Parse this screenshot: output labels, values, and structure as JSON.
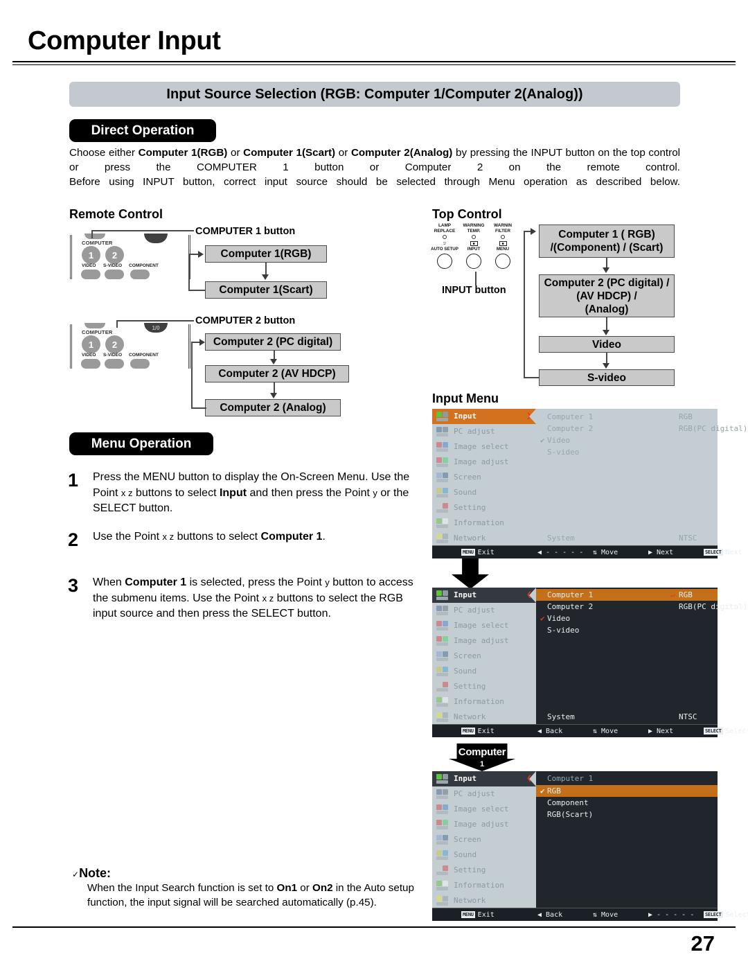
{
  "page": {
    "chapter_title": "Computer Input",
    "section_title": "Input Source Selection (RGB: Computer 1/Computer 2(Analog))",
    "page_number": "27"
  },
  "direct_operation": {
    "heading": "Direct Operation",
    "para_line1_pre": "Choose either ",
    "para_b1": "Computer 1(RGB)",
    "para_mid1": " or ",
    "para_b2": "Computer 1(Scart)",
    "para_mid2": " or ",
    "para_b3": "Computer 2(Analog)",
    "para_line1_post": " by pressing the INPUT button on the top control or press the COMPUTER 1 button or Computer 2 on the remote control.",
    "para_line2": "Before using INPUT button, correct input source should be selected through Menu operation as described below."
  },
  "remote_control": {
    "heading": "Remote Control",
    "computer1_callout": "COMPUTER 1 button",
    "computer2_callout": "COMPUTER 2 button",
    "device_labels": {
      "computer": "COMPUTER",
      "btn1": "1",
      "btn2": "2",
      "video": "VIDEO",
      "svideo": "S-VIDEO",
      "component": "COMPONENT"
    },
    "flow_group1": [
      "Computer 1(RGB)",
      "Computer 1(Scart)"
    ],
    "flow_group2": [
      "Computer 2 (PC digital)",
      "Computer 2 (AV HDCP)",
      "Computer 2 (Analog)"
    ]
  },
  "top_control": {
    "heading": "Top Control",
    "input_button_callout": "INPUT button",
    "indicators": [
      {
        "line1": "LAMP",
        "line2": "REPLACE"
      },
      {
        "line1": "WARNING",
        "line2": "TEMP."
      },
      {
        "line1": "WARNIN",
        "line2": "FILTER"
      }
    ],
    "buttons": [
      "AUTO SETUP",
      "INPUT",
      "MENU"
    ],
    "flow": [
      {
        "line1": "Computer 1 ( RGB)",
        "line2": "/(Component) / (Scart)"
      },
      {
        "line1": "Computer 2 (PC digital) /",
        "line2": "(AV HDCP) /",
        "line3": "(Analog)"
      },
      {
        "line1": "Video"
      },
      {
        "line1": "S-video"
      }
    ]
  },
  "menu_operation": {
    "heading": "Menu Operation",
    "steps": [
      {
        "num": "1",
        "parts": [
          {
            "t": "Press the MENU button to display the On-Screen Menu. Use the Point ",
            "b": false
          },
          {
            "t": "x z",
            "b": false,
            "pt": true
          },
          {
            "t": " buttons to select ",
            "b": false
          },
          {
            "t": "Input",
            "b": true
          },
          {
            "t": " and then press the Point ",
            "b": false
          },
          {
            "t": "y",
            "b": false,
            "pt": true
          },
          {
            "t": " or the SELECT button.",
            "b": false
          }
        ]
      },
      {
        "num": "2",
        "parts": [
          {
            "t": "Use the Point ",
            "b": false
          },
          {
            "t": "x z",
            "b": false,
            "pt": true
          },
          {
            "t": " buttons to select ",
            "b": false
          },
          {
            "t": "Computer 1",
            "b": true
          },
          {
            "t": ".",
            "b": false
          }
        ]
      },
      {
        "num": "3",
        "parts": [
          {
            "t": "When ",
            "b": false
          },
          {
            "t": "Computer 1",
            "b": true
          },
          {
            "t": " is selected, press the Point ",
            "b": false
          },
          {
            "t": "y",
            "b": false,
            "pt": true
          },
          {
            "t": " button to access the submenu items. Use the Point ",
            "b": false
          },
          {
            "t": "x z",
            "b": false,
            "pt": true
          },
          {
            "t": " buttons to select the RGB input source and then press the SELECT button.",
            "b": false
          }
        ]
      }
    ]
  },
  "note": {
    "check": "✓",
    "title": "Note:",
    "parts": [
      {
        "t": "When the Input Search function is set to ",
        "b": false
      },
      {
        "t": "On1",
        "b": true
      },
      {
        "t": " or ",
        "b": false
      },
      {
        "t": "On2",
        "b": true
      },
      {
        "t": " in the Auto setup function, the input signal will be searched automatically (p.45).",
        "b": false
      }
    ]
  },
  "input_menu": {
    "heading": "Input Menu",
    "sidebar_items": [
      {
        "label": "Input",
        "icon": "input-icon"
      },
      {
        "label": "PC adjust",
        "icon": "pc-adjust-icon"
      },
      {
        "label": "Image select",
        "icon": "image-select-icon"
      },
      {
        "label": "Image adjust",
        "icon": "image-adjust-icon"
      },
      {
        "label": "Screen",
        "icon": "screen-icon"
      },
      {
        "label": "Sound",
        "icon": "sound-icon"
      },
      {
        "label": "Setting",
        "icon": "setting-icon"
      },
      {
        "label": "Information",
        "icon": "information-icon"
      },
      {
        "label": "Network",
        "icon": "network-icon"
      }
    ],
    "screen1": {
      "chevron": "❯",
      "rows": [
        {
          "label": "Computer 1",
          "value": "RGB",
          "check": ""
        },
        {
          "label": "Computer 2",
          "value": "RGB(PC digital)",
          "check": ""
        },
        {
          "label": "Video",
          "value": "",
          "check": "✔"
        },
        {
          "label": "S-video",
          "value": "",
          "check": ""
        }
      ],
      "system_label": "System",
      "system_value": "NTSC",
      "bar": [
        {
          "key": "MENU",
          "label": "Exit"
        },
        {
          "key": "",
          "label": "◀ - - - - -"
        },
        {
          "key": "",
          "label": "⇅ Move"
        },
        {
          "key": "",
          "label": "▶ Next"
        },
        {
          "key": "SELECT",
          "label": "Next"
        }
      ]
    },
    "screen2": {
      "chevron": "❮",
      "rows": [
        {
          "label": "Computer 1",
          "value": "RGB",
          "check": "",
          "enter": "↵",
          "highlight": true
        },
        {
          "label": "Computer 2",
          "value": "RGB(PC digital)",
          "check": "",
          "highlight": false
        },
        {
          "label": "Video",
          "value": "",
          "check": "✔",
          "highlight": false
        },
        {
          "label": "S-video",
          "value": "",
          "check": "",
          "highlight": false
        }
      ],
      "system_label": "System",
      "system_value": "NTSC",
      "bar": [
        {
          "key": "MENU",
          "label": "Exit"
        },
        {
          "key": "",
          "label": "◀ Back"
        },
        {
          "key": "",
          "label": "⇅ Move"
        },
        {
          "key": "",
          "label": "▶ Next"
        },
        {
          "key": "SELECT",
          "label": "Select"
        }
      ]
    },
    "screen3": {
      "chevron": "❮",
      "title": "Computer 1",
      "rows": [
        {
          "label": "RGB",
          "check": "✔",
          "highlight": true
        },
        {
          "label": "Component",
          "check": "",
          "highlight": false
        },
        {
          "label": "RGB(Scart)",
          "check": "",
          "highlight": false
        }
      ],
      "callout": "Computer",
      "callout_sub": "1",
      "bar": [
        {
          "key": "MENU",
          "label": "Exit"
        },
        {
          "key": "",
          "label": "◀ Back"
        },
        {
          "key": "",
          "label": "⇅ Move"
        },
        {
          "key": "",
          "label": "▶ - - - - -"
        },
        {
          "key": "SELECT",
          "label": "Select"
        }
      ]
    }
  },
  "colors": {
    "osd_highlight": "#d4711e",
    "osd_dark": "#2b3138",
    "osd_sidebar": "#c3cdd2",
    "band_grey": "#c3c9ce",
    "flowbox_grey": "#c9c9c9"
  }
}
